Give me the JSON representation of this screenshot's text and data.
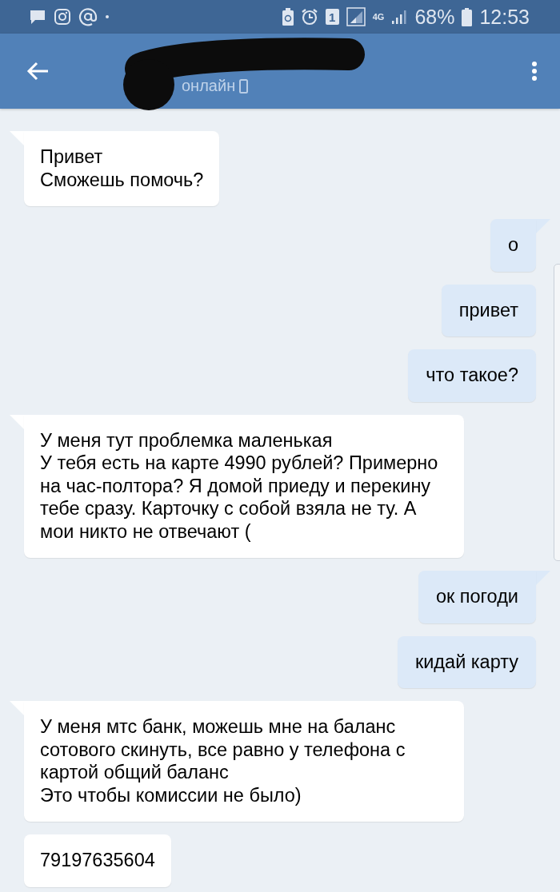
{
  "status_bar": {
    "sim_slot": "1",
    "network": "4G",
    "battery": "68%",
    "time": "12:53"
  },
  "header": {
    "subtitle": "онлайн"
  },
  "messages": [
    {
      "outgoing": false,
      "tail": true,
      "text": "Привет\nСможешь помочь?"
    },
    {
      "outgoing": true,
      "tail": true,
      "text": "о"
    },
    {
      "outgoing": true,
      "tail": false,
      "text": "привет"
    },
    {
      "outgoing": true,
      "tail": false,
      "text": "что такое?"
    },
    {
      "outgoing": false,
      "tail": true,
      "text": "У меня тут проблемка маленькая\nУ тебя есть на карте 4990 рублей? Примерно на час-полтора? Я домой приеду и перекину тебе сразу. Карточку с собой взяла не ту. А мои никто не отвечают ("
    },
    {
      "outgoing": true,
      "tail": true,
      "text": "ок погоди"
    },
    {
      "outgoing": true,
      "tail": false,
      "text": "кидай карту"
    },
    {
      "outgoing": false,
      "tail": true,
      "text": "У меня мтс банк, можешь мне на баланс сотового скинуть, все равно у телефона с картой общий баланс\nЭто чтобы комиссии не было)"
    },
    {
      "outgoing": false,
      "tail": false,
      "text": "79197635604"
    }
  ]
}
